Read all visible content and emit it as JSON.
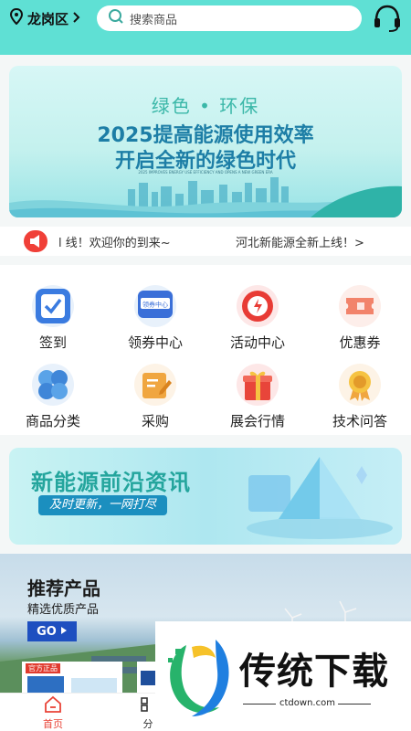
{
  "header": {
    "location": "龙岗区",
    "search_placeholder": "搜索商品",
    "colors": {
      "header_bg": "#5fe0d4"
    },
    "icons": [
      "location-pin-icon",
      "chevron-right-icon",
      "search-icon",
      "customer-service-icon"
    ]
  },
  "banner": {
    "line1": "绿色 • 环保",
    "line2": "2025提高能源使用效率",
    "line3": "开启全新的绿色时代",
    "small_text": "2025 IMPROVES ENERGY USE EFFICIENCY AND OPENS A NEW GREEN ERA"
  },
  "notice": {
    "text1": "l 线！欢迎你的到来~",
    "text2": "河北新能源全新上线！>"
  },
  "grid": {
    "items": [
      {
        "label": "签到",
        "icon": "checkbox-icon"
      },
      {
        "label": "领券中心",
        "icon": "coupon-center-icon"
      },
      {
        "label": "活动中心",
        "icon": "alarm-clock-icon"
      },
      {
        "label": "优惠券",
        "icon": "ticket-icon"
      },
      {
        "label": "商品分类",
        "icon": "categories-icon"
      },
      {
        "label": "采购",
        "icon": "purchase-note-icon"
      },
      {
        "label": "展会行情",
        "icon": "gift-box-icon"
      },
      {
        "label": "技术问答",
        "icon": "medal-icon"
      }
    ],
    "coupon_icon_text": "领券中心"
  },
  "promo": {
    "title": "新能源前沿资讯",
    "subtitle": "及时更新，一网打尽"
  },
  "recommend": {
    "title": "推荐产品",
    "subtitle": "精选优质产品",
    "go_label": "GO",
    "card_badge": "官方正品"
  },
  "tabbar": {
    "home": "首页",
    "category": "分"
  },
  "watermark": {
    "text": "传统下载",
    "url": "ctdown.com"
  }
}
